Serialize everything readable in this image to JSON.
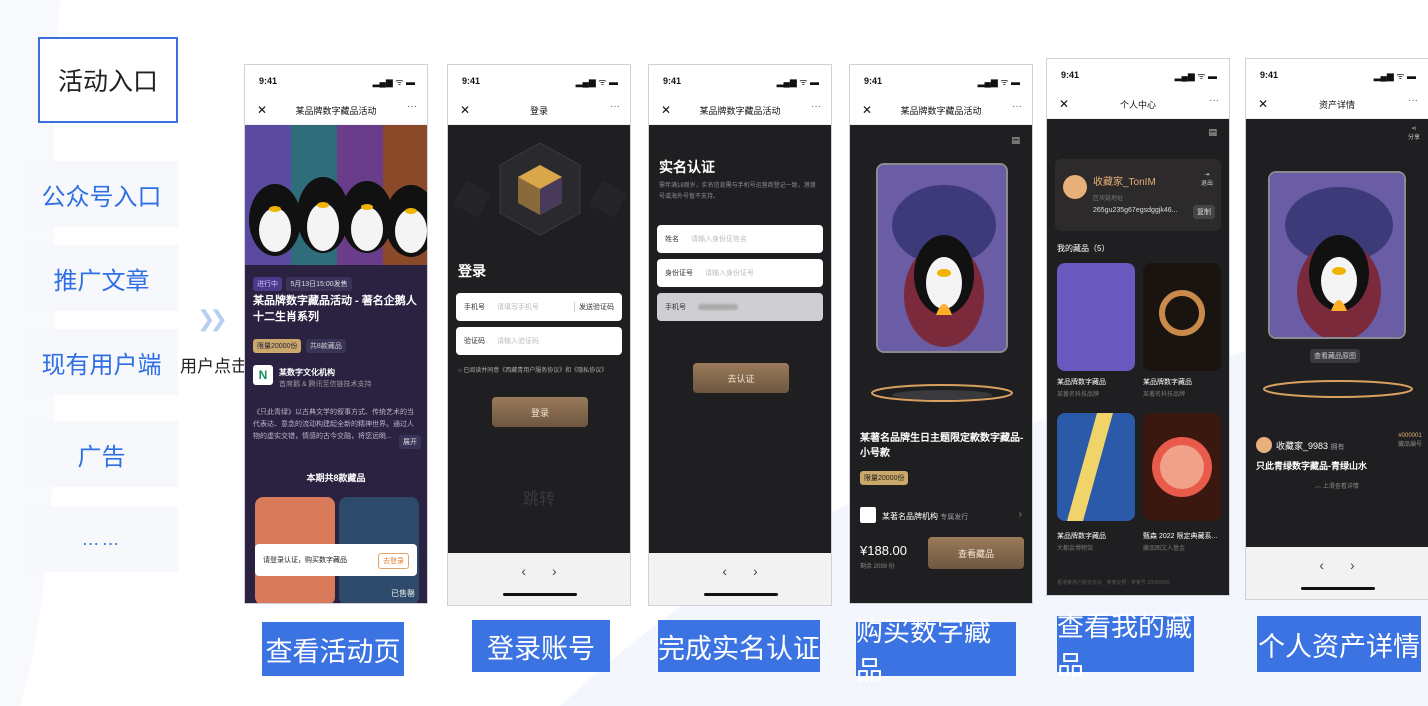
{
  "entry": {
    "title": "活动入口",
    "items": [
      "公众号入口",
      "推广文章",
      "现有用户端",
      "广告",
      "……"
    ]
  },
  "user_click": "用户点击",
  "status_time": "9:41",
  "phones": [
    {
      "nav_title": "某品牌数字藏品活动",
      "tag_status": "进行中",
      "tag_date": "5月13日15:00发售",
      "heading": "某品牌数字藏品活动 - 著名企鹅人十二生肖系列",
      "limit": "限量20000份",
      "count_tag": "共8款藏品",
      "org_name": "某数字文化机构",
      "org_sub": "首席鹅 & 腾讯至信链技术支持",
      "desc": "《只此青绿》以古典文学的叙事方式、传统艺术的当代表达、意念的流动构建起全新的精神世界。通过人物的虚实交错，情感的古今交融，将您远眺...",
      "expand": "展开",
      "section_title": "本期共8款藏品",
      "login_tip": "请登录认证，购买数字藏品",
      "login_btn": "去登录",
      "sold_label": "已售罄"
    },
    {
      "nav_title": "登录",
      "heading": "登录",
      "phone_label": "手机号",
      "phone_ph": "请填写手机号",
      "send_code": "发送验证码",
      "code_label": "验证码",
      "code_ph": "请输入验证码",
      "agree": "已阅读并同意《西藏青用户服务协议》和《隐私协议》",
      "login_btn": "登录",
      "jump": "跳转"
    },
    {
      "nav_title": "某品牌数字藏品活动",
      "heading": "实名认证",
      "note": "需年满18周岁，实名信息需与手机号运营商登记一致，港澳号或海外号暂不支持。",
      "name_label": "姓名",
      "name_ph": "请输入身份证姓名",
      "id_label": "身份证号",
      "id_ph": "请输入身份证号",
      "mobile_label": "手机号",
      "submit": "去认证"
    },
    {
      "nav_title": "某品牌数字藏品活动",
      "title": "某著名品牌生日主题限定款数字藏品-小号款",
      "limit": "限量20000份",
      "publisher": "某著名品牌机构",
      "publisher_suffix": "专属发行",
      "price": "¥188.00",
      "stock": "剩余 2099 份",
      "buy_btn": "查看藏品"
    },
    {
      "nav_title": "个人中心",
      "nickname": "收藏家_TonIM",
      "chain_label": "区块链地址",
      "chain_addr": "265gu235g67egsdggjk46...",
      "copy": "复制",
      "exit": "退出",
      "my_title": "我的藏品（5）",
      "items": [
        {
          "name": "某品牌数字藏品",
          "sub": "某著名科技品牌"
        },
        {
          "name": "某品牌数字藏品",
          "sub": "某著名科技品牌"
        },
        {
          "name": "某品牌数字藏品",
          "sub": "大都会博物馆"
        },
        {
          "name": "甄森 2022 限定典藏系...",
          "sub": "藏品图文人基金"
        }
      ],
      "footer": "香港某用户服务协议 · 某某证照 · 某某号-20080059"
    },
    {
      "nav_title": "资产详情",
      "share": "分享",
      "view_btn": "查看藏品原图",
      "owner": "收藏家_9983",
      "owner_suffix": "拥有",
      "title": "只此青绿数字藏品-青绿山水",
      "serial": "#000001",
      "serial_label": "藏品编号",
      "more": "上滑查看详情"
    }
  ],
  "captions": [
    "查看活动页",
    "登录账号",
    "完成实名认证",
    "购买数字藏品",
    "查看我的藏品",
    "个人资产详情"
  ],
  "colors": {
    "accent": "#3b73e3",
    "entry_text": "#2f6fe4",
    "dark_screen": "#1f1f22",
    "gold": "#9a7b5a"
  }
}
